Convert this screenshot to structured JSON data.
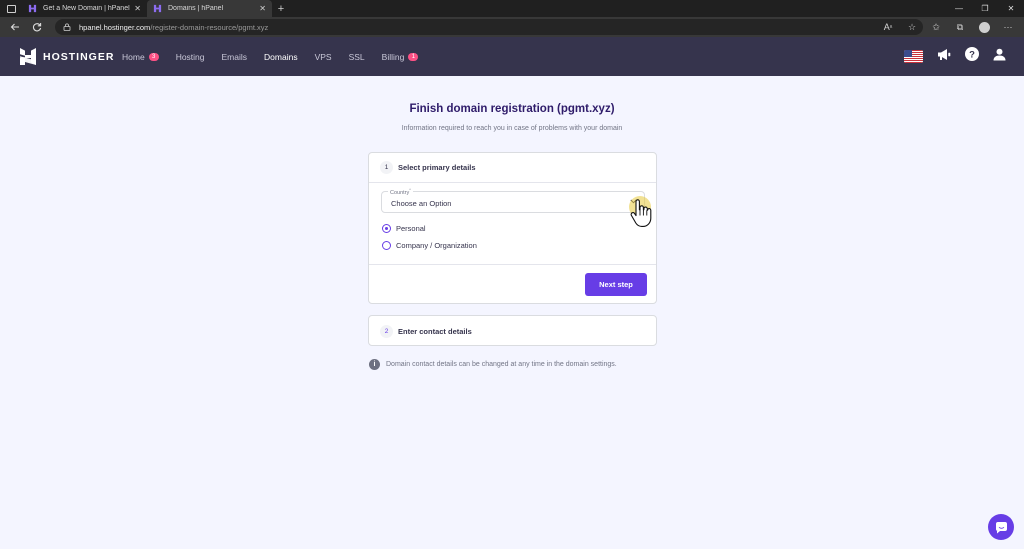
{
  "browser": {
    "tabs": [
      {
        "title": "Get a New Domain | hPanel",
        "active": false
      },
      {
        "title": "Domains | hPanel",
        "active": true
      }
    ],
    "url_host": "hpanel.hostinger.com",
    "url_path": "/register-domain-resource/pgmt.xyz",
    "window_controls": {
      "minimize": "—",
      "restore": "❐",
      "close": "✕"
    }
  },
  "header": {
    "logo_text": "HOSTINGER",
    "nav": [
      {
        "label": "Home",
        "badge": "3"
      },
      {
        "label": "Hosting",
        "badge": ""
      },
      {
        "label": "Emails",
        "badge": ""
      },
      {
        "label": "Domains",
        "badge": ""
      },
      {
        "label": "VPS",
        "badge": ""
      },
      {
        "label": "SSL",
        "badge": ""
      },
      {
        "label": "Billing",
        "badge": "1"
      }
    ],
    "active_nav": "Domains"
  },
  "page": {
    "title": "Finish domain registration (pgmt.xyz)",
    "subtitle": "Information required to reach you in case of problems with your domain",
    "step1": {
      "number": "1",
      "label": "Select primary details",
      "country_label": "Country",
      "country_required_mark": "*",
      "country_value": "Choose an Option",
      "radio_options": [
        {
          "label": "Personal",
          "checked": true
        },
        {
          "label": "Company / Organization",
          "checked": false
        }
      ],
      "next_button": "Next step"
    },
    "step2": {
      "number": "2",
      "label": "Enter contact details"
    },
    "info_note": "Domain contact details can be changed at any time in the domain settings."
  },
  "colors": {
    "brand_purple": "#673de6",
    "header_bg": "#36344d",
    "badge_pink": "#fc5185",
    "page_bg": "#f4f5ff"
  }
}
